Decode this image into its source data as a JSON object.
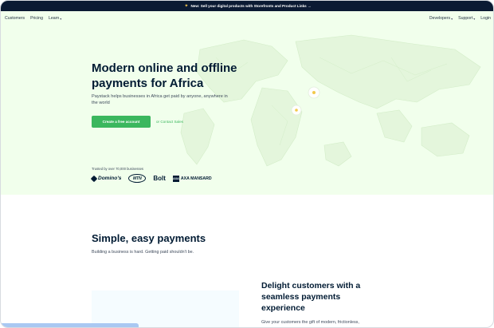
{
  "announcement": {
    "icon": "sparkle-icon",
    "text": "New: Sell your digital products with Storefronts and Product Links →"
  },
  "nav": {
    "left": [
      {
        "label": "Customers"
      },
      {
        "label": "Pricing"
      },
      {
        "label": "Learn",
        "dropdown": true
      }
    ],
    "right": [
      {
        "label": "Developers",
        "dropdown": true
      },
      {
        "label": "Support",
        "dropdown": true
      },
      {
        "label": "Login"
      }
    ]
  },
  "hero": {
    "title": "Modern online and offline payments for Africa",
    "subtitle": "Paystack helps businesses in Africa get paid by anyone, anywhere in the world",
    "primary_cta": "Create a free account",
    "secondary_cta": "or Contact Sales",
    "trusted_text": "Trusted by over 70,000 businesses",
    "logos": {
      "dominos": "Domino's",
      "mtn": "MTN",
      "bolt": "Bolt",
      "axa_mark": "AXA",
      "axa": "AXA MANSARD"
    }
  },
  "section": {
    "title": "Simple, easy payments",
    "subtitle": "Building a business is hard. Getting paid shouldn't be."
  },
  "feature": {
    "title": "Delight customers with a seamless payments experience",
    "text": "Give your customers the gift of modern, frictionless,"
  },
  "colors": {
    "brand_green": "#3BB75E",
    "navy": "#011B33",
    "hero_bg": "#F1FFEC",
    "announce_bg": "#0B1A33"
  }
}
